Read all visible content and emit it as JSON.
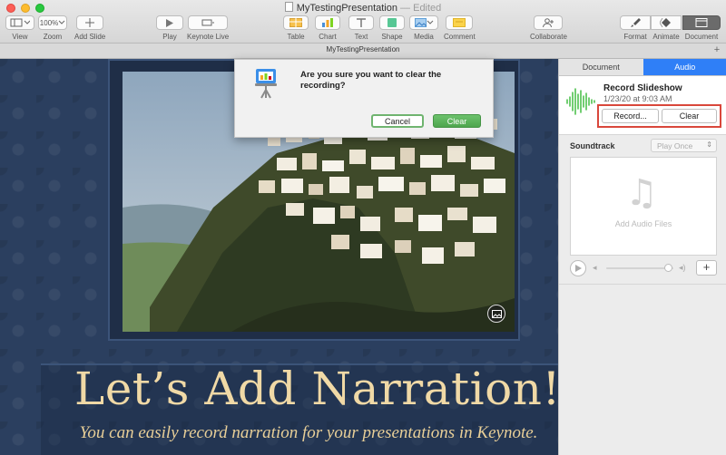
{
  "window": {
    "title": "MyTestingPresentation",
    "edited_suffix": "— Edited",
    "tab_title": "MyTestingPresentation"
  },
  "toolbar": {
    "view_label": "View",
    "zoom_value": "100%",
    "zoom_label": "Zoom",
    "add_slide_label": "Add Slide",
    "play_label": "Play",
    "keynote_live_label": "Keynote Live",
    "table_label": "Table",
    "chart_label": "Chart",
    "text_label": "Text",
    "shape_label": "Shape",
    "media_label": "Media",
    "comment_label": "Comment",
    "collaborate_label": "Collaborate",
    "format_label": "Format",
    "animate_label": "Animate",
    "document_label": "Document"
  },
  "slide": {
    "title": "Let’s Add Narration!",
    "subtitle": "You can easily record narration for your presentations in Keynote."
  },
  "dialog": {
    "message": "Are you sure you want to clear the recording?",
    "cancel_label": "Cancel",
    "clear_label": "Clear"
  },
  "inspector": {
    "tabs": [
      {
        "label": "Document",
        "active": false
      },
      {
        "label": "Audio",
        "active": true
      }
    ],
    "recording": {
      "title": "Record Slideshow",
      "date": "1/23/20 at 9:03 AM",
      "record_label": "Record...",
      "clear_label": "Clear"
    },
    "soundtrack": {
      "label": "Soundtrack",
      "play_mode": "Play Once",
      "drop_text": "Add Audio Files"
    },
    "player": {
      "volume_level": 0.92,
      "add_label": "+"
    }
  },
  "colors": {
    "accent": "#2f7ff7",
    "clear_button": "#55ab55",
    "highlight_outline": "#d9473b",
    "slide_background": "#2b3f5f",
    "title_gold": "#f0d9a6"
  },
  "icons": {
    "view": "sidebar-view-icon",
    "add_slide": "plus-icon",
    "play": "play-icon",
    "keynote_live": "monitor-icon",
    "table": "table-icon",
    "chart": "chart-icon",
    "text": "text-icon",
    "shape": "shape-icon",
    "media": "media-icon",
    "comment": "comment-icon",
    "collaborate": "person-plus-icon",
    "format": "paintbrush-icon",
    "animate": "diamond-icon",
    "document": "document-icon",
    "waveform": "waveform-icon",
    "music_note": "music-note-icon",
    "image_badge": "image-icon"
  }
}
